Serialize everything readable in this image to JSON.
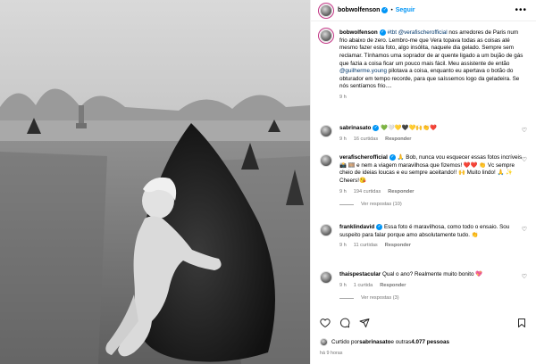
{
  "post": {
    "author": "bobwolfenson",
    "follow_label": "Seguir",
    "separator": "•",
    "more_label": "•••",
    "caption_hashtag": "#tbt",
    "caption_mention": "@verafischerofficial",
    "caption_text1": " nos arredores de Paris num frio abaixo de zero. Lembro-me que Vera topava todas as coisas até mesmo fazer esta foto, algo insólita, naquele dia gelado. Sempre sem reclamar. Tínhamos uma soprador de ar quente ligado a um bujão de gás que fazia a coisa ficar um pouco mais fácil. Meu assistente de então ",
    "caption_mention2": "@guilherme.young",
    "caption_text2": " pilotava a coisa, enquanto eu apertava o botão do obturador em tempo recorde, para que saíssemos logo da geladeira. Se nós sentíamos frio....",
    "caption_time": "9 h"
  },
  "comments": [
    {
      "user": "sabrinasato",
      "text": "💚🤍💛🖤💛🙌👏❤️",
      "time": "9 h",
      "likes": "16 curtidas",
      "reply": "Responder"
    },
    {
      "user": "verafischerofficial",
      "text": "🙏 Bob, nunca vou esquecer essas fotos incríveis 📸 🎞️ e nem a viagem maravilhosa que fizemos! ❤️❤️ 👏 Vc sempre cheio de ideias loucas e eu sempre aceitando!! 🙌 Muito lindo! 🙏 ✨ Cheers!😘",
      "time": "9 h",
      "likes": "194 curtidas",
      "reply": "Responder",
      "view_replies": "Ver respostas (10)"
    },
    {
      "user": "franklindavid",
      "text": "Essa foto é maravilhosa, como todo o ensaio. Sou suspeito para falar porque amo absolutamente tudo. 👏",
      "time": "9 h",
      "likes": "11 curtidas",
      "reply": "Responder"
    },
    {
      "user": "thaispestacular",
      "text": "Qual o ano? Realmente muito bonito 💖",
      "time": "9 h",
      "likes": "1 curtida",
      "reply": "Responder",
      "view_replies": "Ver respostas (3)"
    }
  ],
  "footer": {
    "liked_by_prefix": "Curtido por ",
    "liked_by_user": "sabrinasato",
    "liked_by_suffix": " e outras ",
    "liked_count": "4.077 pessoas",
    "time_ago": "há 9 horas"
  },
  "icons": {
    "heart": "heart-icon",
    "comment": "comment-icon",
    "share": "share-icon",
    "bookmark": "bookmark-icon",
    "verified": "verified-badge-icon"
  },
  "colors": {
    "accent": "#0095f6",
    "muted": "#737373",
    "mention": "#00376b"
  }
}
